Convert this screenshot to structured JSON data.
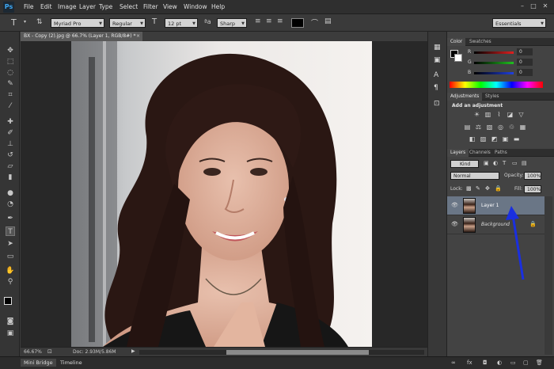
{
  "app": {
    "logo": "Ps"
  },
  "menu": [
    "File",
    "Edit",
    "Image",
    "Layer",
    "Type",
    "Select",
    "Filter",
    "View",
    "Window",
    "Help"
  ],
  "options": {
    "font_family": "Myriad Pro",
    "font_style": "Regular",
    "font_size": "12 pt",
    "antialias": "Sharp",
    "workspace": "Essentials"
  },
  "document": {
    "tab_title": "BX - Copy (2).jpg @ 66.7% (Layer 1, RGB/8#) *",
    "zoom": "66.67%",
    "doc_size": "Doc: 2.93M/5.86M"
  },
  "bottom_tabs": [
    "Mini Bridge",
    "Timeline"
  ],
  "color_panel": {
    "tabs": [
      "Color",
      "Swatches"
    ],
    "channels": [
      {
        "label": "R",
        "value": "0",
        "color": "#e02020"
      },
      {
        "label": "G",
        "value": "0",
        "color": "#20c020"
      },
      {
        "label": "B",
        "value": "0",
        "color": "#2040e0"
      }
    ]
  },
  "adjustments_panel": {
    "tabs": [
      "Adjustments",
      "Styles"
    ],
    "heading": "Add an adjustment"
  },
  "layers_panel": {
    "tabs": [
      "Layers",
      "Channels",
      "Paths"
    ],
    "filter": "Kind",
    "blend_mode": "Normal",
    "opacity_label": "Opacity:",
    "opacity_value": "100%",
    "lock_label": "Lock:",
    "fill_label": "Fill:",
    "fill_value": "100%",
    "layers": [
      {
        "name": "Layer 1",
        "selected": true
      },
      {
        "name": "Background",
        "selected": false,
        "locked": true
      }
    ]
  },
  "annotation": {
    "arrow_color": "#1a2fe0"
  }
}
